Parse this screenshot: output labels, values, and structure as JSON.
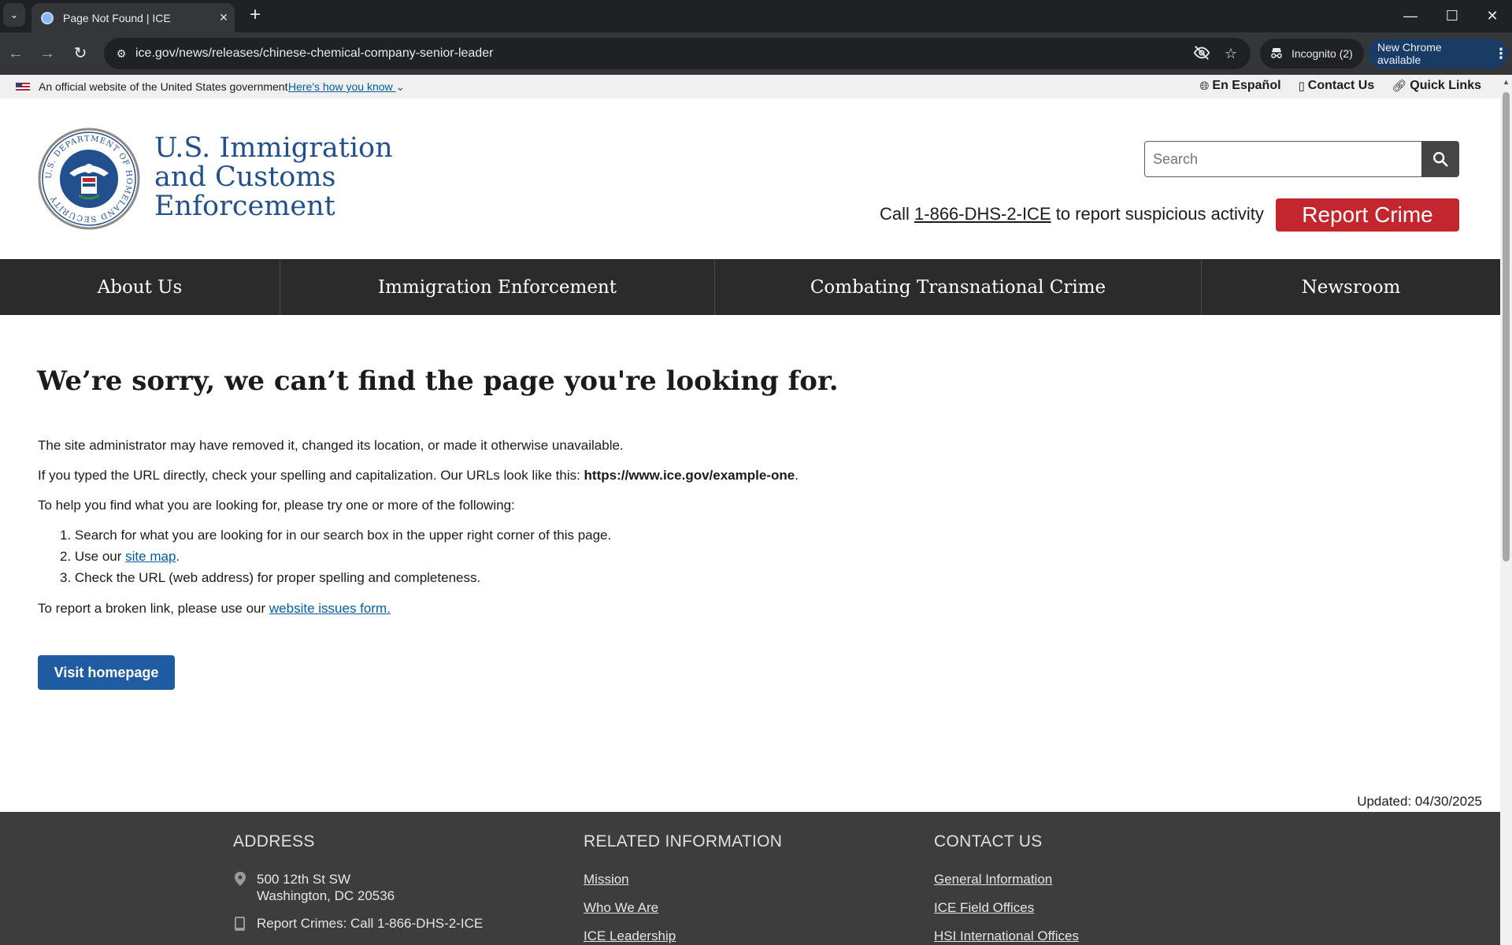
{
  "browser": {
    "tab_title": "Page Not Found | ICE",
    "url": "ice.gov/news/releases/chinese-chemical-company-senior-leader",
    "incognito_label": "Incognito (2)",
    "update_label": "New Chrome available",
    "icons": {
      "tab_search": "chevron-down-icon",
      "new_tab": "plus-icon",
      "back": "arrow-left-icon",
      "forward": "arrow-right-icon",
      "reload": "reload-icon",
      "site_info": "tune-icon",
      "tracking": "eye-off-icon",
      "bookmark": "star-icon"
    }
  },
  "gov_banner": {
    "text": "An official website of the United States government",
    "how_you_know": "Here's how you know",
    "links": {
      "espanol": "En Español",
      "contact": "Contact Us",
      "quick": "Quick Links"
    }
  },
  "header": {
    "agency_line1": "U.S. Immigration",
    "agency_line2": "and Customs",
    "agency_line3": "Enforcement",
    "seal_text": "U.S. DEPARTMENT OF HOMELAND SECURITY",
    "search_placeholder": "Search",
    "call_prefix": "Call ",
    "call_number": "1-866-DHS-2-ICE",
    "call_suffix": " to report suspicious activity",
    "report_button": "Report Crime",
    "colors": {
      "brand_blue": "#22508e",
      "report_red": "#c4262e",
      "nav_bg": "#2b2b2b"
    }
  },
  "nav": {
    "items": [
      {
        "label": "About Us"
      },
      {
        "label": "Immigration Enforcement"
      },
      {
        "label": "Combating Transnational Crime"
      },
      {
        "label": "Newsroom"
      }
    ]
  },
  "main": {
    "title": "We’re sorry, we can’t find the page you're looking for.",
    "p1": "The site administrator may have removed it, changed its location, or made it otherwise unavailable.",
    "p2_prefix": "If you typed the URL directly, check your spelling and capitalization. Our URLs look like this: ",
    "p2_url": "https://www.ice.gov/example-one",
    "p2_suffix": ".",
    "p3": "To help you find what you are looking for, please try one or more of the following:",
    "list": {
      "item1": "1. Search for what you are looking for in our search box in the upper right corner of this page.",
      "item2_prefix": "2. Use our ",
      "item2_link": "site map",
      "item2_suffix": ".",
      "item3": "3. Check the URL (web address) for proper spelling and completeness."
    },
    "p4_prefix": "To report a broken link, please use our ",
    "p4_link": "website issues form.",
    "visit_button": "Visit homepage",
    "updated": "Updated: 04/30/2025"
  },
  "footer": {
    "address_heading": "ADDRESS",
    "address_line1": "500 12th St SW",
    "address_line2": "Washington, DC 20536",
    "report_line": "Report Crimes: Call 1-866-DHS-2-ICE",
    "related_heading": "RELATED INFORMATION",
    "related": {
      "mission": "Mission",
      "who": "Who We Are",
      "leadership": "ICE Leadership"
    },
    "contact_heading": "CONTACT US",
    "contact": {
      "general": "General Information",
      "field": "ICE Field Offices",
      "hsi": "HSI International Offices"
    }
  }
}
